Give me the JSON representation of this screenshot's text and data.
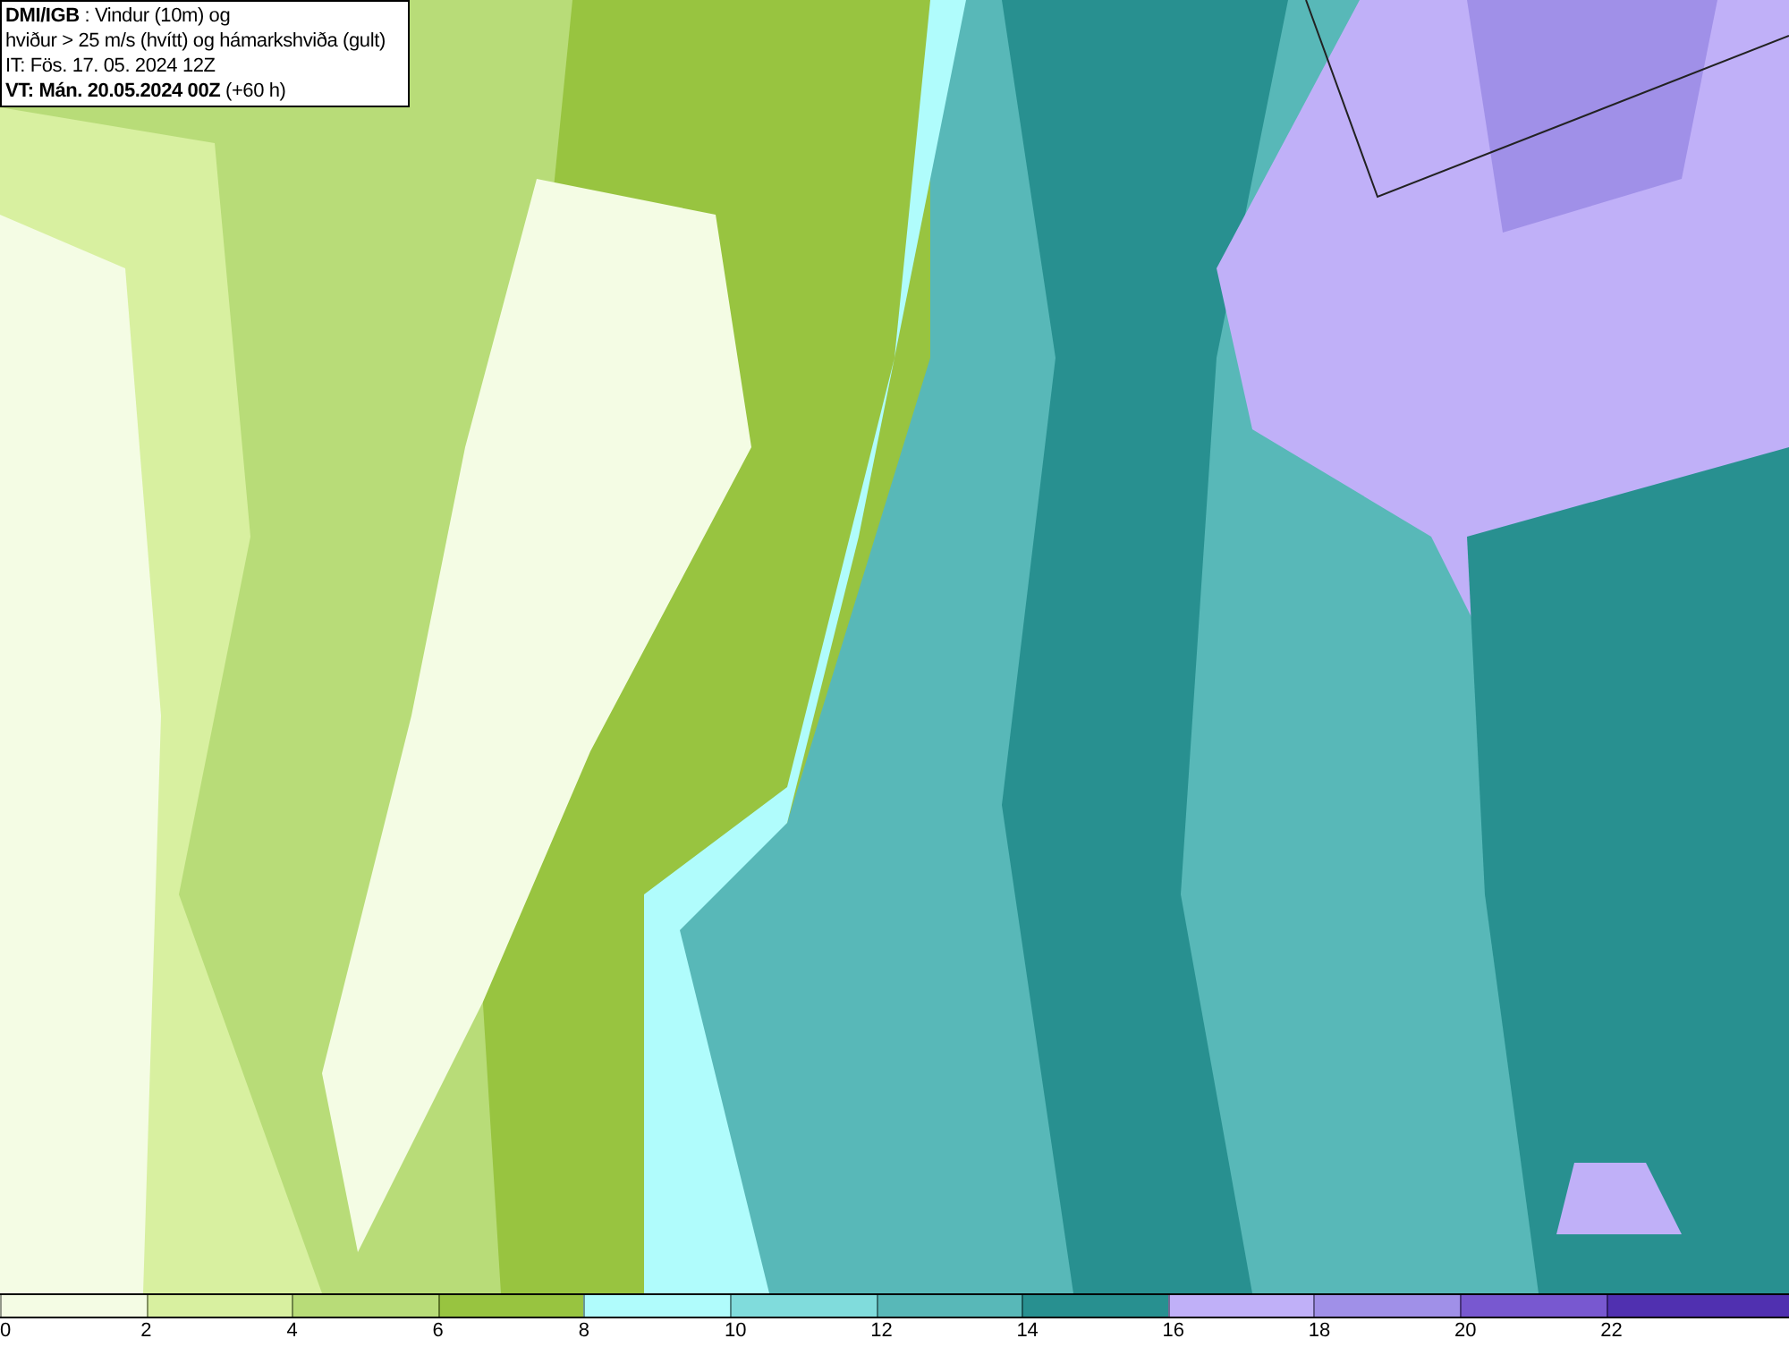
{
  "info_box": {
    "lines": [
      "**DMI/IGB** : Vindur (10m) og",
      "hviður > 25 m/s (hvítt) og hámarkshviða (gult)",
      "IT: Fös. 17. 05. 2024 12Z",
      "**VT: Mán. 20.05.2024 00Z** (+60 h)"
    ]
  },
  "legend": {
    "segments": [
      {
        "color": "#f4fce4"
      },
      {
        "color": "#d8f0a0"
      },
      {
        "color": "#b8dc78"
      },
      {
        "color": "#98c440"
      },
      {
        "color": "#b0fcfc"
      },
      {
        "color": "#80dcdc"
      },
      {
        "color": "#58b8b8"
      },
      {
        "color": "#289090"
      },
      {
        "color": "#c0b0f8"
      },
      {
        "color": "#a090e8"
      },
      {
        "color": "#7858d0"
      },
      {
        "color": "#5030b0"
      }
    ],
    "ticks": [
      "0",
      "2",
      "4",
      "6",
      "8",
      "10",
      "12",
      "14",
      "16",
      "18",
      "20",
      "22"
    ]
  }
}
